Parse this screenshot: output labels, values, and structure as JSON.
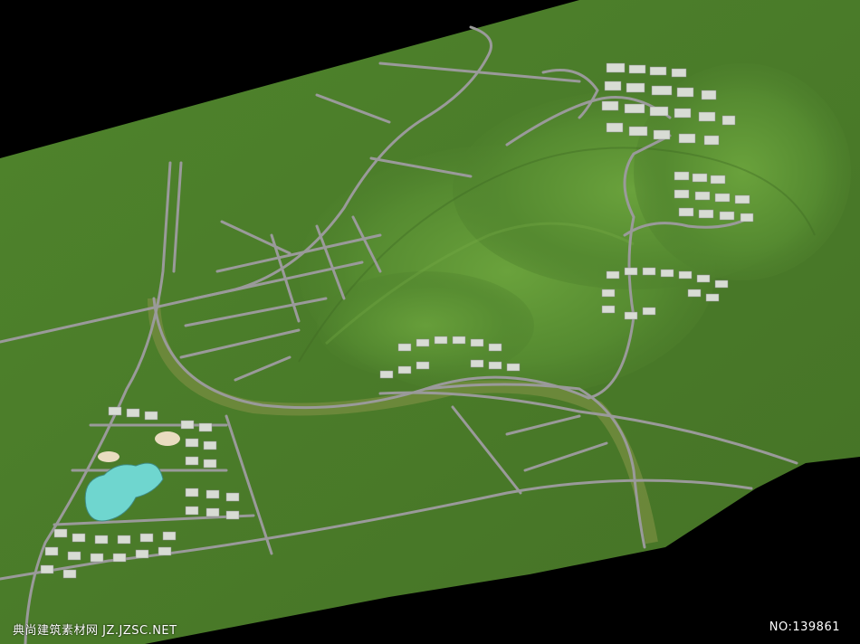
{
  "watermark": {
    "left_text": "典尚建筑素材网 JZ.JZSC.NET",
    "right_text": "NO:139861"
  },
  "colors": {
    "background": "#000000",
    "ground": "#4a7a2a",
    "hill": "#5d9436",
    "road": "#9a9a9a",
    "road_edge": "#6f6f6f",
    "building": "#d8dcd4",
    "lake": "#6fd6cf",
    "greenbelt": "#6f8a3c"
  }
}
